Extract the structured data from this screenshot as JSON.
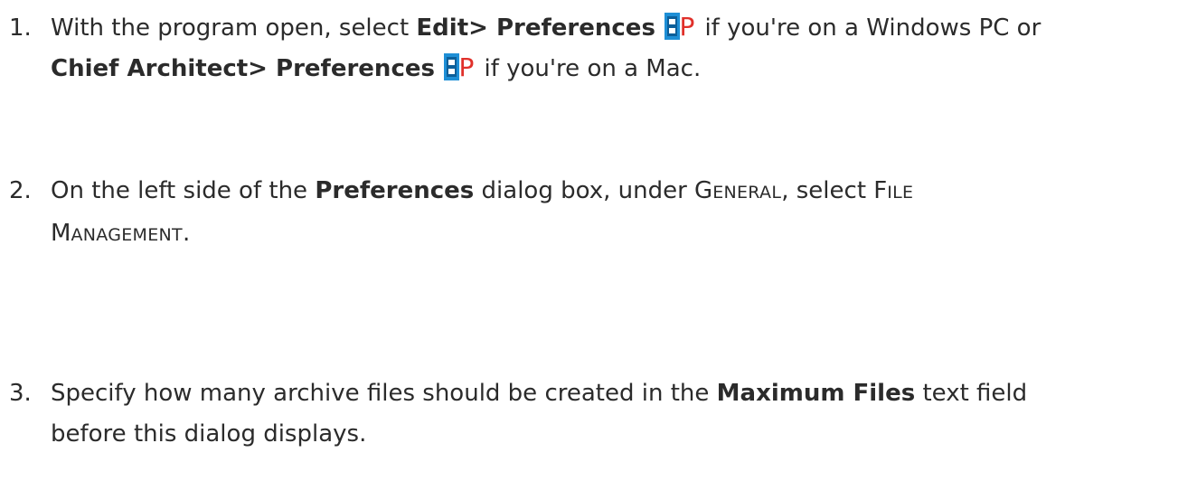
{
  "steps": [
    {
      "number": "1.",
      "line1": {
        "t1": "With the program open, select ",
        "b1": "Edit> Preferences",
        "t2": " if you're on a Windows PC or"
      },
      "line2": {
        "b1": "Chief Architect> Preferences",
        "t2": " if you're on a Mac."
      },
      "icon": "preferences-icon"
    },
    {
      "number": "2.",
      "line1": {
        "t1": "On the left side of the ",
        "b1": "Preferences",
        "t2": " dialog box, under ",
        "sc1_big": "G",
        "sc1_small": "ENERAL",
        "t3": ", select ",
        "sc2_big": "F",
        "sc2_small": "ILE"
      },
      "line2": {
        "sc3_big": "M",
        "sc3_small": "ANAGEMENT",
        "t1": "."
      }
    },
    {
      "number": "3.",
      "line1": {
        "t1": "Specify how many archive files should be created in the ",
        "b1": "Maximum Files",
        "t2": " text field"
      },
      "line2": {
        "t1": "before this dialog displays."
      }
    }
  ],
  "colors": {
    "text": "#2b2b2b",
    "icon_blue": "#1e8fd6",
    "icon_red": "#e0302a"
  }
}
